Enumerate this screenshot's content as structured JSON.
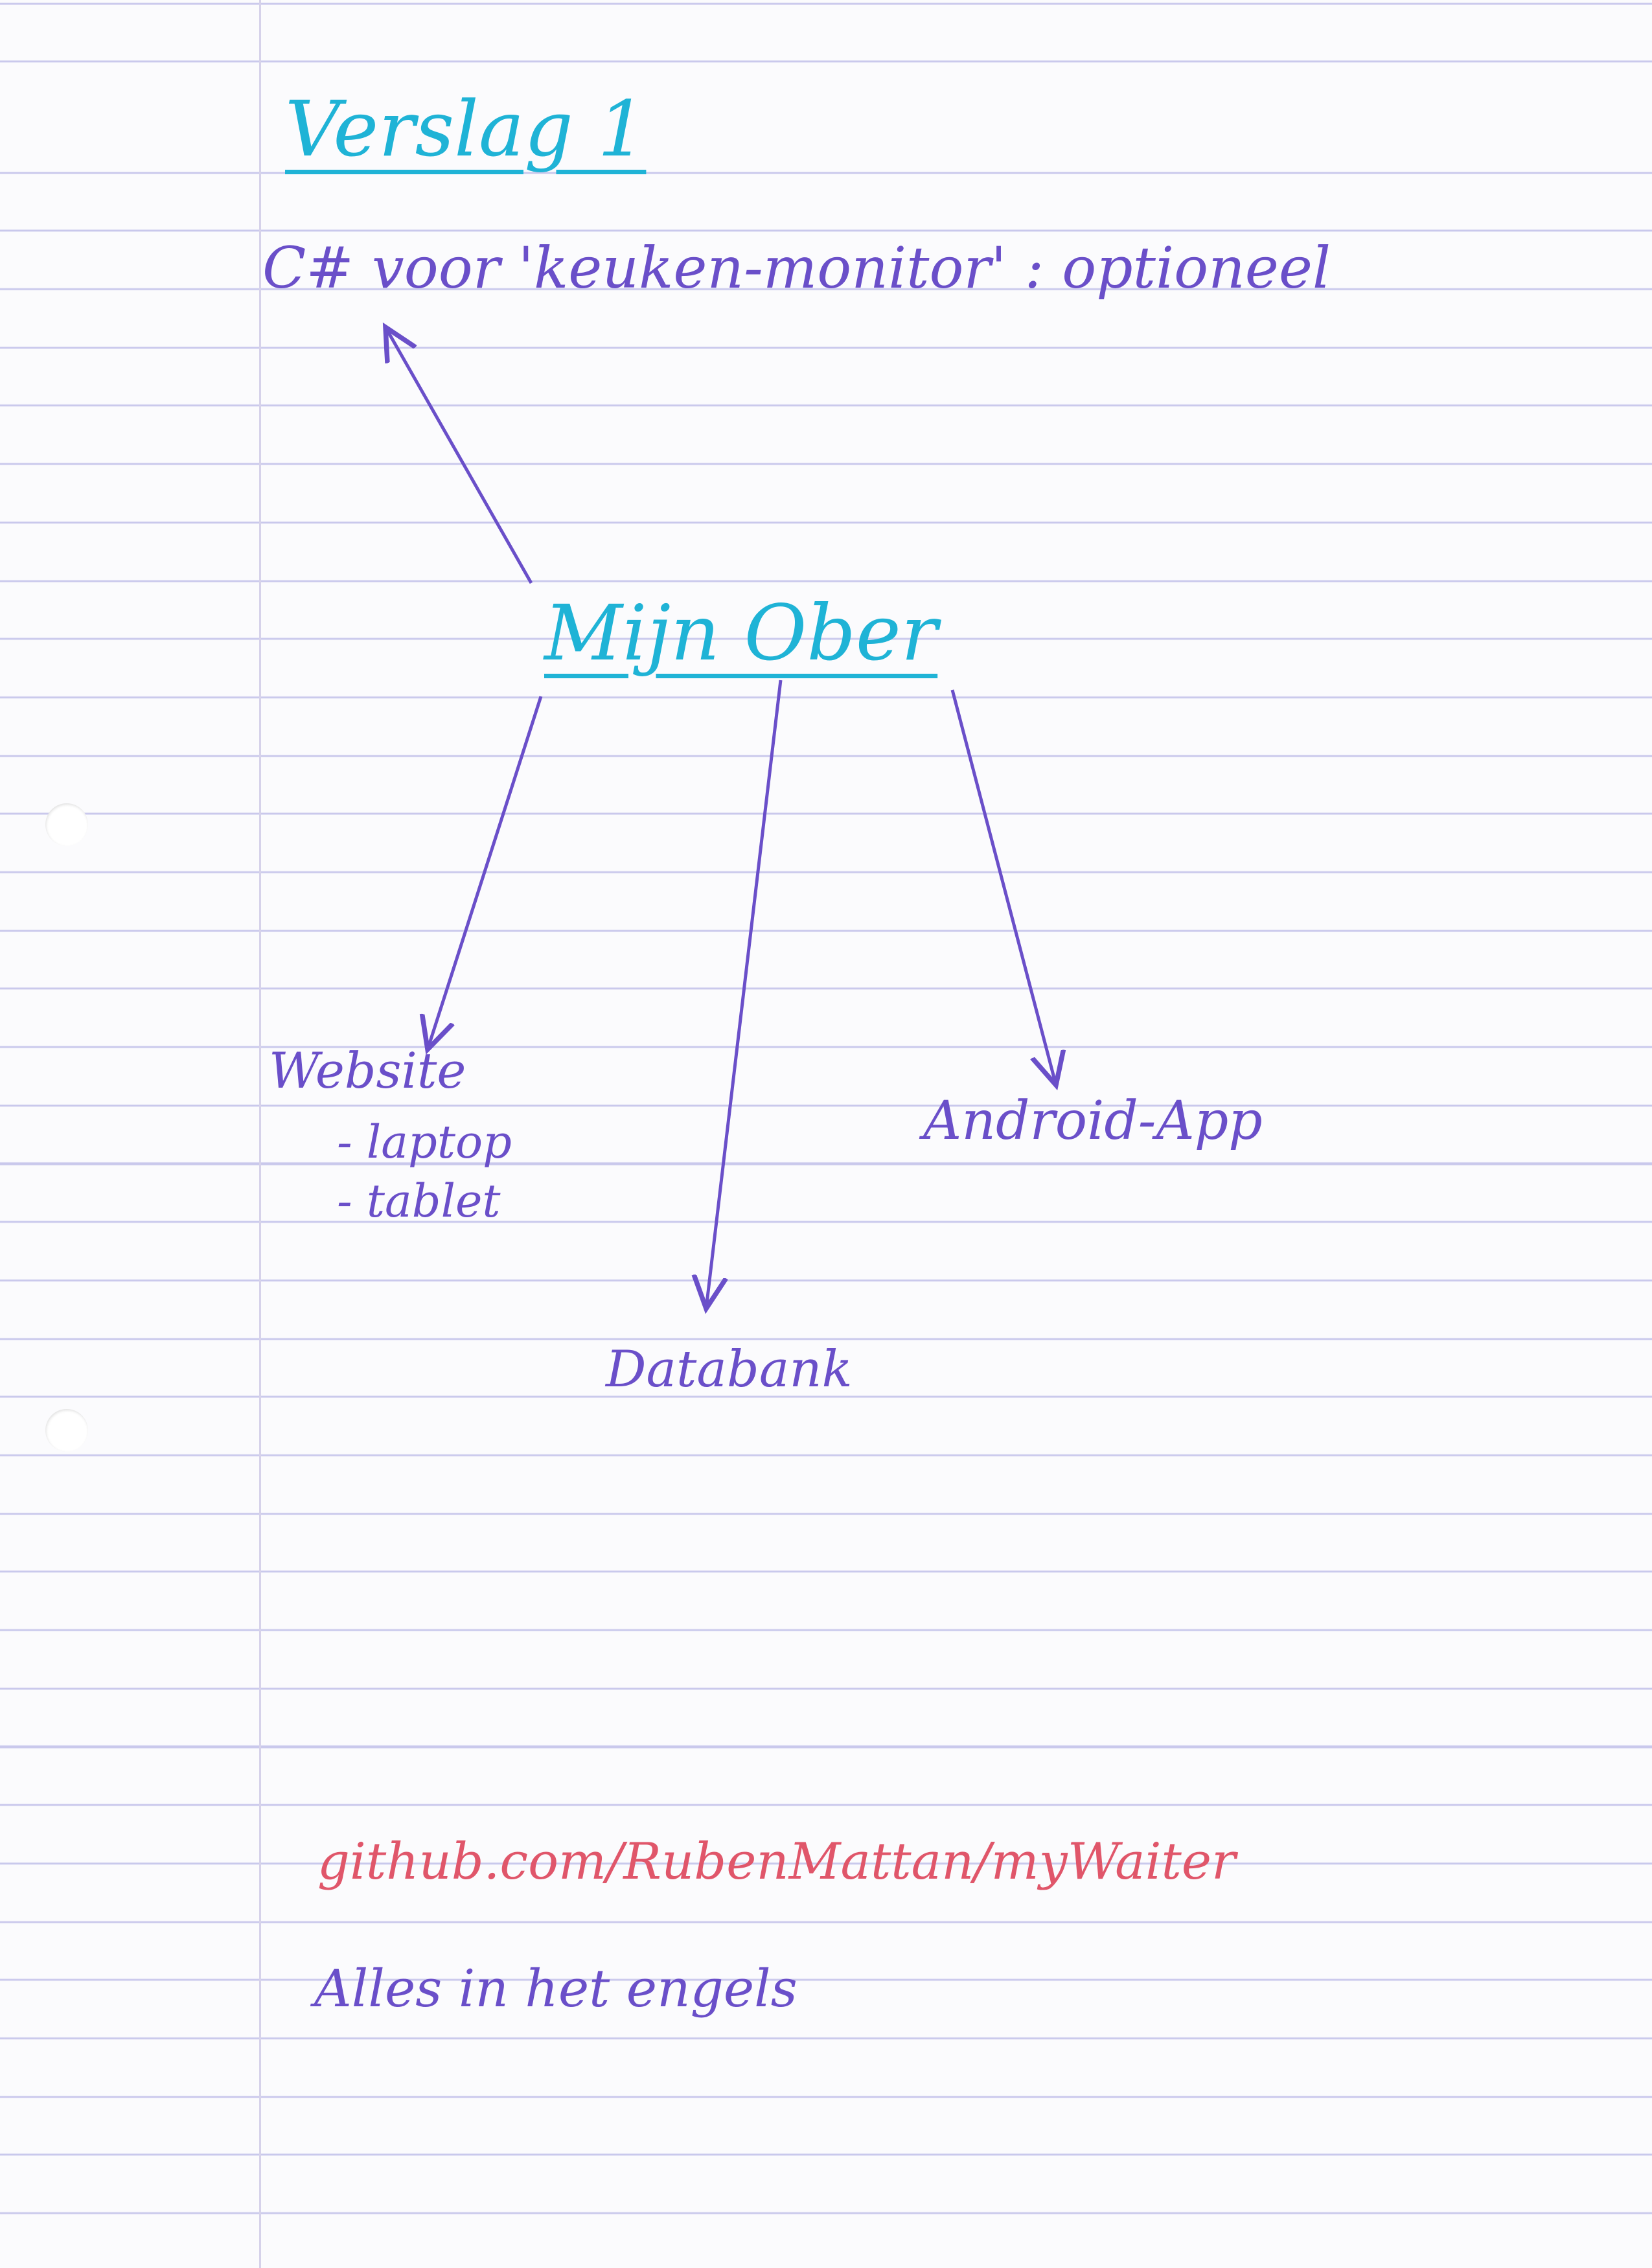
{
  "title": "Verslag 1",
  "subtitle_line": "C# voor 'keuken-monitor' : optioneel",
  "hub": "Mijn Ober",
  "nodes": {
    "website": {
      "label": "Website",
      "items": [
        "- laptop",
        "- tablet"
      ]
    },
    "android": "Android-App",
    "database": "Databank"
  },
  "footer": {
    "url": "github.com/RubenMattan/myWaiter",
    "note": "Alles in het engels"
  },
  "colors": {
    "title_ink": "#1fb3d6",
    "body_ink": "#6a4fc9",
    "url_ink": "#e0566a",
    "paper_rule": "#c9c8ec"
  }
}
